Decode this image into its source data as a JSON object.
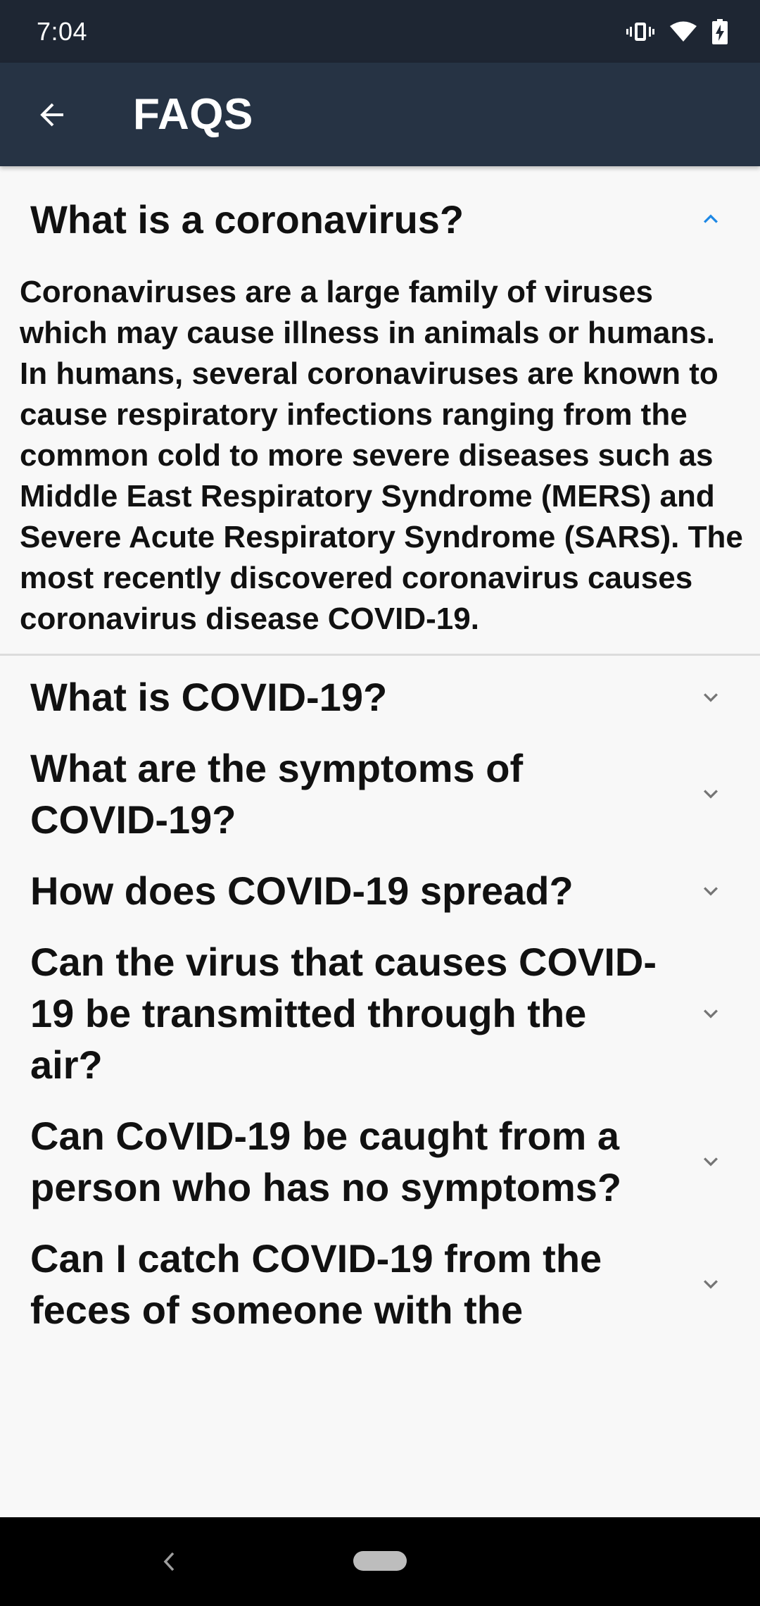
{
  "status_bar": {
    "time": "7:04",
    "icons": [
      "vibrate-icon",
      "wifi-icon",
      "battery-charging-icon"
    ]
  },
  "app_bar": {
    "title": "FAQS",
    "back_icon": "arrow-back-icon"
  },
  "colors": {
    "status_bar_bg": "#1e2633",
    "app_bar_bg": "#263344",
    "accent_chevron": "#1e88e5",
    "chevron_gray": "#757575",
    "background": "#f8f8f8"
  },
  "faqs": [
    {
      "question": "What is a coronavirus?",
      "expanded": true,
      "answer": "Coronaviruses are a large family of viruses which may cause illness in animals or humans. In humans, several coronaviruses are known to cause respiratory infections ranging from the common cold to more severe diseases such as Middle East Respiratory Syndrome (MERS) and Severe Acute Respiratory Syndrome (SARS). The most recently discovered coronavirus causes coronavirus disease COVID-19."
    },
    {
      "question": "What is COVID-19?",
      "expanded": false
    },
    {
      "question": "What are the symptoms of COVID-19?",
      "expanded": false
    },
    {
      "question": "How does COVID-19 spread?",
      "expanded": false
    },
    {
      "question": "Can the virus that causes COVID-19 be transmitted through the air?",
      "expanded": false
    },
    {
      "question": "Can CoVID-19 be caught from a person who has no symptoms?",
      "expanded": false
    },
    {
      "question": "Can I catch COVID-19 from the feces of someone with the",
      "expanded": false
    }
  ]
}
